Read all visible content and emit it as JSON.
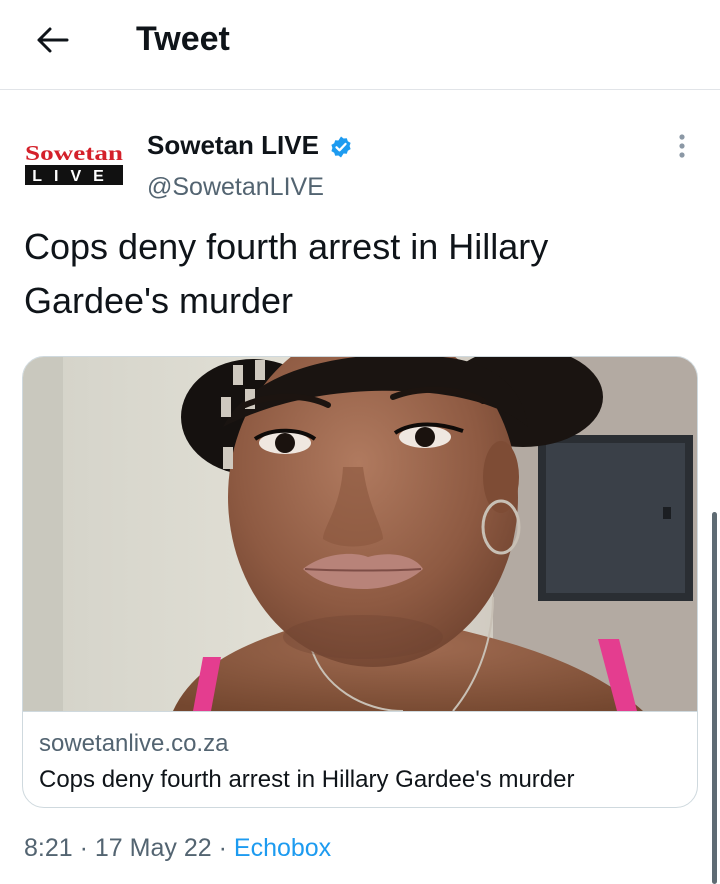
{
  "header": {
    "title": "Tweet",
    "back_icon": "arrow-left-icon"
  },
  "author": {
    "logo_text_top": "Sowetan",
    "logo_text_bottom": "LIVE",
    "name": "Sowetan LIVE",
    "handle": "@SowetanLIVE",
    "verified": true,
    "verified_color": "#1d9bf0"
  },
  "tweet": {
    "text": "Cops deny fourth arrest in Hillary Gardee's murder"
  },
  "card": {
    "domain": "sowetanlive.co.za",
    "title": "Cops deny fourth arrest in Hillary Gardee's murder"
  },
  "meta": {
    "time": "8:21",
    "separator": "·",
    "date": "17 May 22",
    "source": "Echobox",
    "source_color": "#1d9bf0"
  },
  "colors": {
    "brand_red": "#d4202a",
    "text_primary": "#0f1419",
    "text_secondary": "#536471",
    "border": "#cfd9de"
  }
}
